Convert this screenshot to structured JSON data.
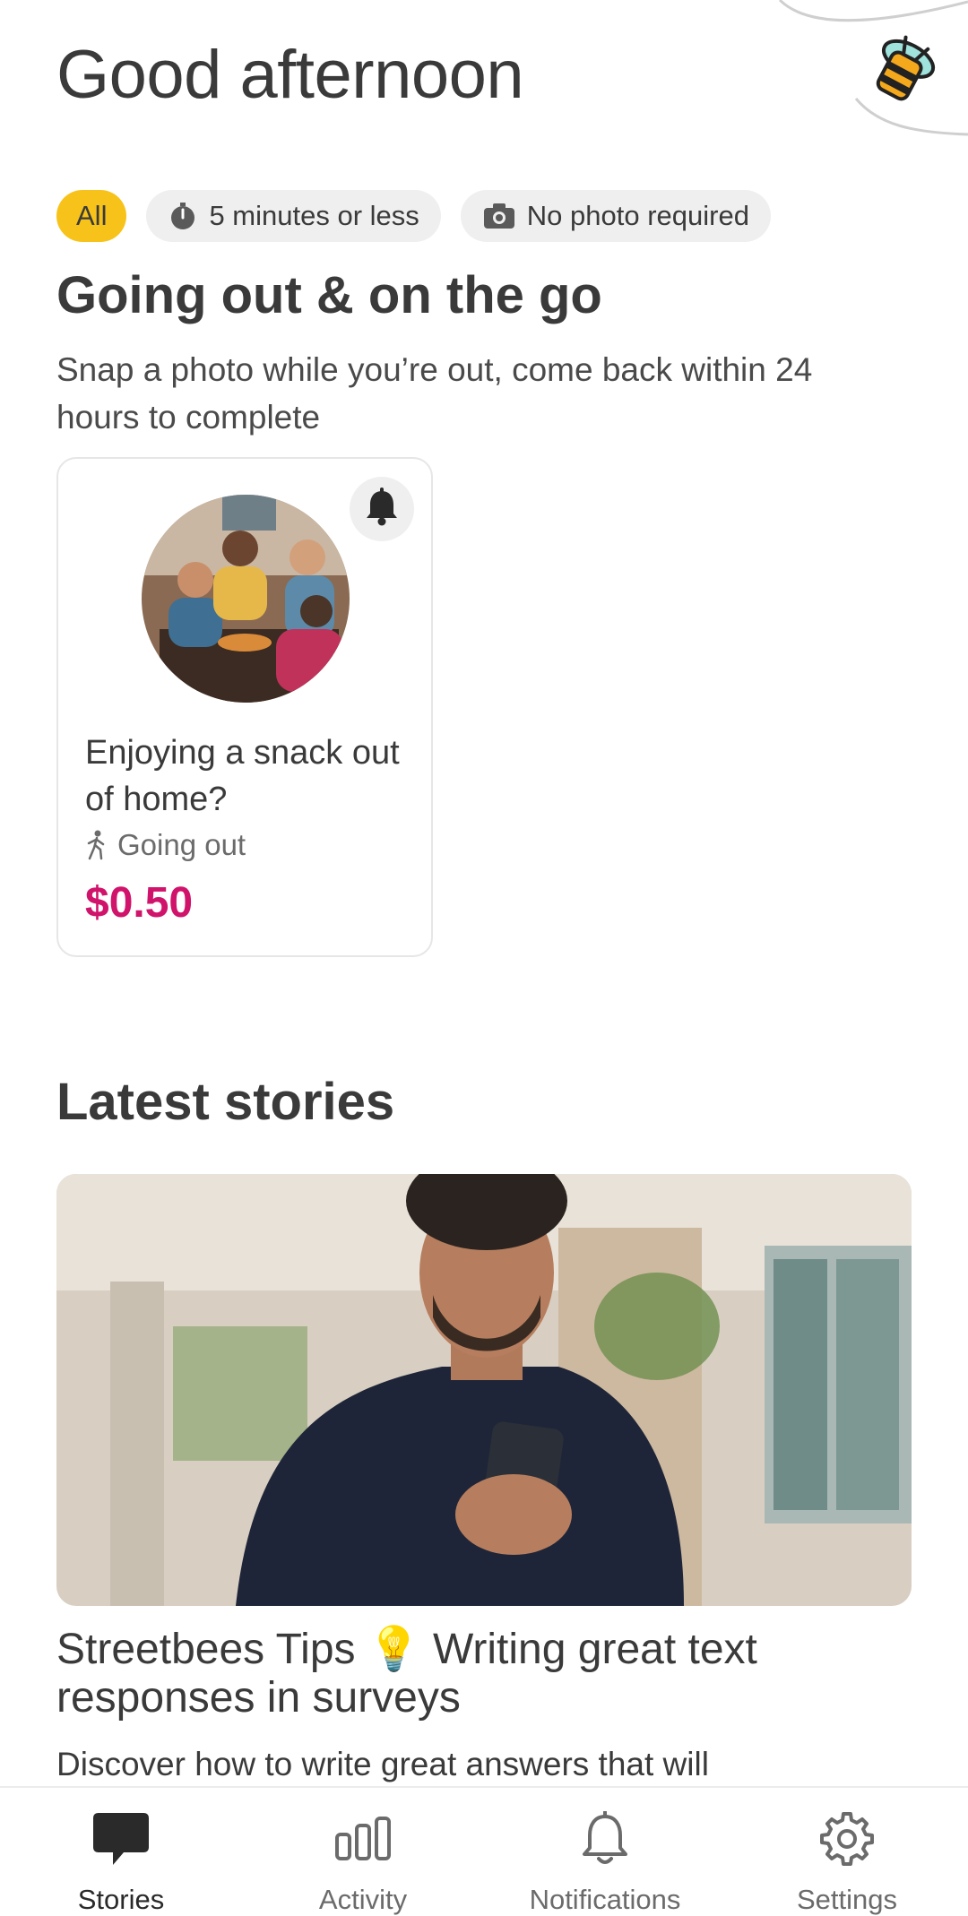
{
  "header": {
    "greeting": "Good afternoon",
    "logo_icon": "bee-icon"
  },
  "filters": [
    {
      "label": "All",
      "active": true
    },
    {
      "label": "5 minutes or less",
      "icon": "timer-icon"
    },
    {
      "label": "No photo required",
      "icon": "camera-icon"
    }
  ],
  "section": {
    "title": "Going out & on the go",
    "description": "Snap a photo while you’re out, come back within 24 hours to complete"
  },
  "task_card": {
    "title": "Enjoying a snack out of home?",
    "category": "Going out",
    "price": "$0.50",
    "price_color": "#d0136b"
  },
  "latest": {
    "title": "Latest stories",
    "story_title": "Streetbees Tips 💡 Writing great text responses in surveys",
    "story_desc": "Discover how to write great answers that will"
  },
  "nav": {
    "items": [
      {
        "label": "Stories",
        "icon": "chat-bubble-icon",
        "active": true
      },
      {
        "label": "Activity",
        "icon": "bar-chart-icon"
      },
      {
        "label": "Notifications",
        "icon": "bell-icon"
      },
      {
        "label": "Settings",
        "icon": "gear-icon"
      }
    ]
  },
  "colors": {
    "accent": "#f7c31a",
    "price": "#d0136b",
    "chip_bg": "#efefef"
  }
}
